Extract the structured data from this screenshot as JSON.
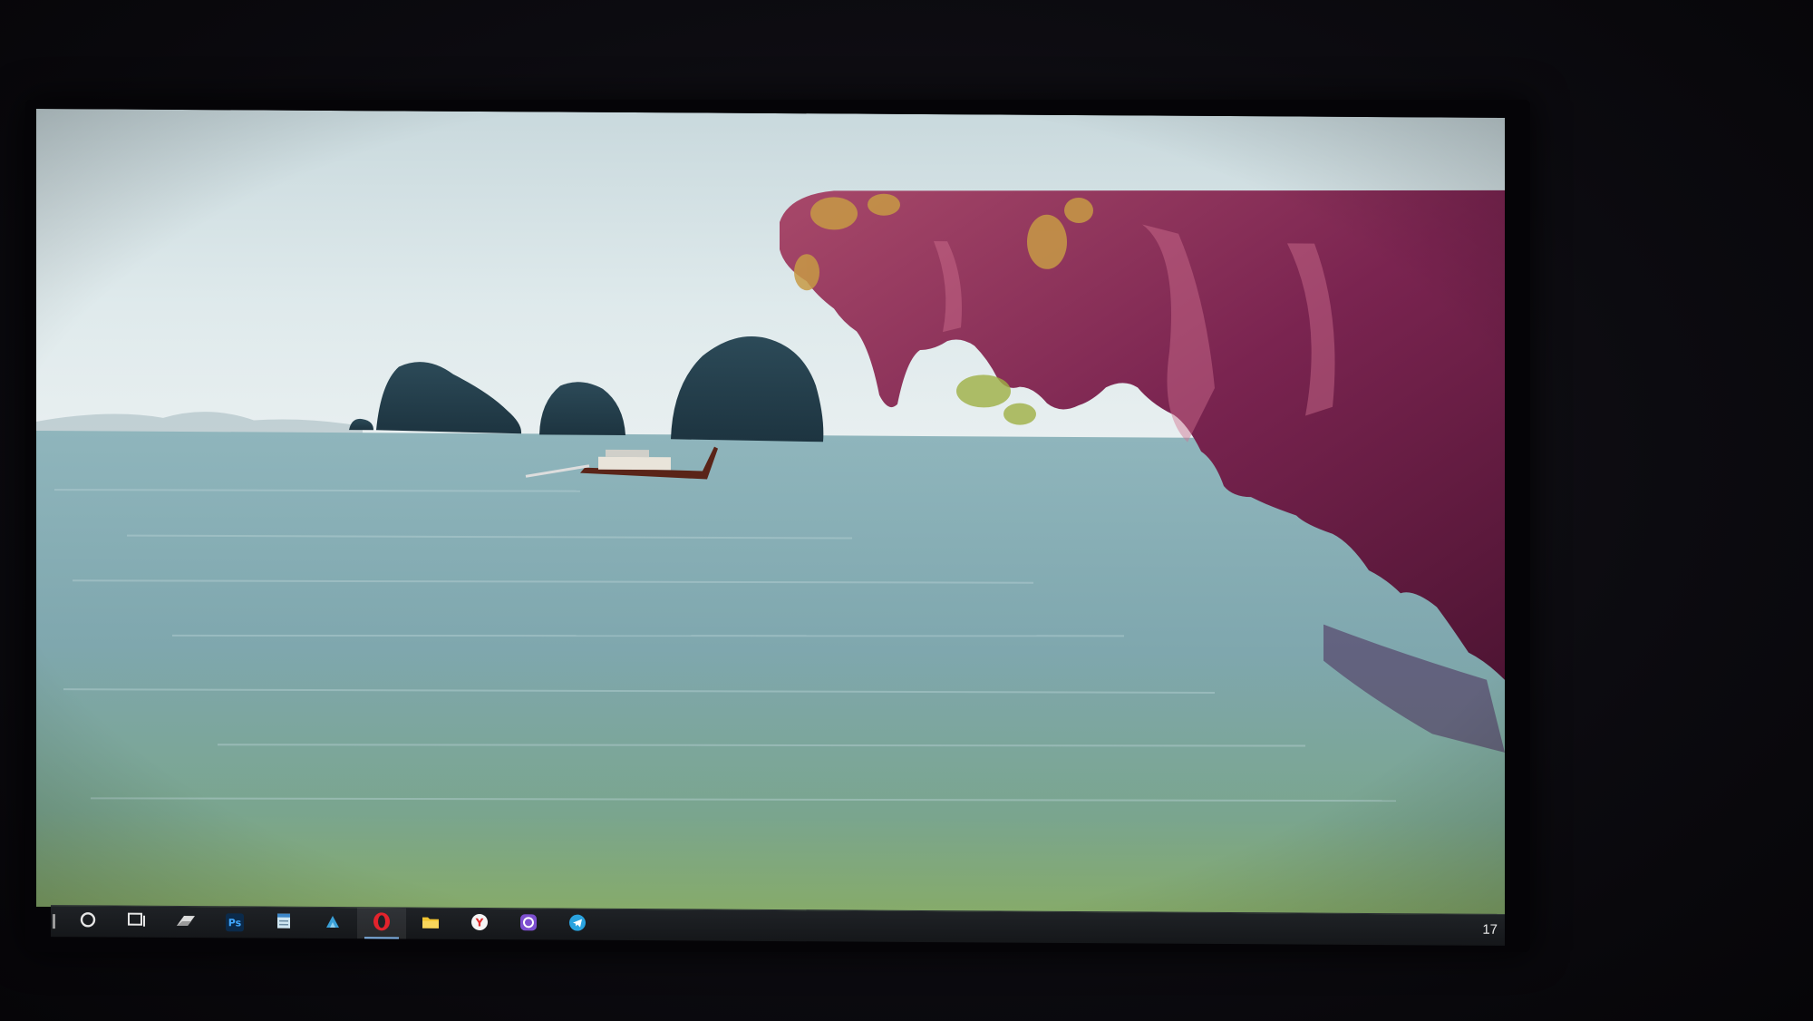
{
  "wallpaper": {
    "description_hidden": "",
    "sky_color": "#d9e6ea",
    "sea_color": "#7fa8ad",
    "cliff_color": "#8a2d5a"
  },
  "taskbar": {
    "items": [
      {
        "icon": "cortana-search-icon"
      },
      {
        "icon": "task-view-icon"
      },
      {
        "icon": "app-icon"
      },
      {
        "icon": "photoshop-icon",
        "label": "Ps"
      },
      {
        "icon": "notepad-icon"
      },
      {
        "icon": "app-icon"
      },
      {
        "icon": "opera-icon",
        "label": "O"
      },
      {
        "icon": "file-explorer-icon"
      },
      {
        "icon": "yandex-browser-icon",
        "label": "Y"
      },
      {
        "icon": "viber-icon"
      },
      {
        "icon": "telegram-icon"
      }
    ],
    "clock": "17"
  }
}
